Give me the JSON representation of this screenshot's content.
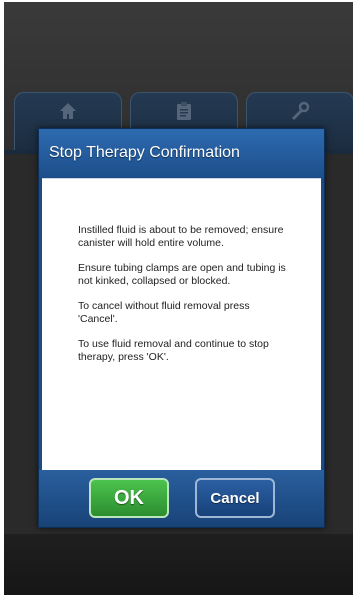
{
  "tabs": [
    {
      "icon": "home-icon"
    },
    {
      "icon": "clipboard-icon"
    },
    {
      "icon": "tools-icon"
    }
  ],
  "dialog": {
    "title": "Stop Therapy Confirmation",
    "messages": [
      "Instilled fluid is about to be removed; ensure canister will hold entire volume.",
      "Ensure tubing clamps are open and tubing is not kinked, collapsed or blocked.",
      "To cancel without fluid removal press 'Cancel'.",
      "To use fluid removal and continue to stop therapy, press 'OK'."
    ],
    "ok_label": "OK",
    "cancel_label": "Cancel"
  },
  "colors": {
    "dialog_header": "#2d6bb0",
    "ok_button": "#3aa83d",
    "cancel_button": "#1f4f8c",
    "background": "#2b2b2b"
  }
}
